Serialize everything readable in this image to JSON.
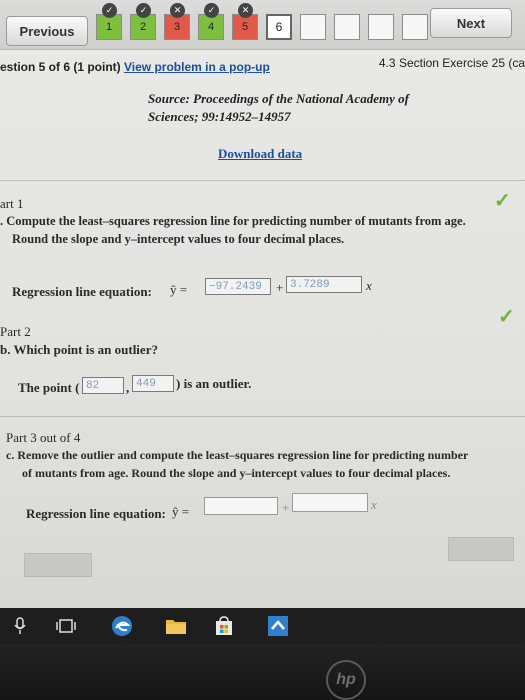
{
  "nav": {
    "previous_label": "Previous",
    "next_label": "Next",
    "questions": [
      {
        "label": "1",
        "state": "green",
        "badge": "✓"
      },
      {
        "label": "2",
        "state": "green",
        "badge": "✓"
      },
      {
        "label": "3",
        "state": "red",
        "badge": "✕"
      },
      {
        "label": "4",
        "state": "green",
        "badge": "✓"
      },
      {
        "label": "5",
        "state": "red",
        "badge": "✕"
      },
      {
        "label": "6",
        "state": "current",
        "badge": ""
      },
      {
        "label": "",
        "state": "white",
        "badge": ""
      },
      {
        "label": "",
        "state": "white",
        "badge": ""
      },
      {
        "label": "",
        "state": "white",
        "badge": ""
      },
      {
        "label": "",
        "state": "white",
        "badge": ""
      }
    ]
  },
  "question": {
    "info": "estion 5 of 6 (1 point)",
    "view_link": "View problem in a pop-up",
    "section": "4.3 Section Exercise 25 (ca"
  },
  "source": {
    "line1": "Source: Proceedings of the National Academy of",
    "line2": "Sciences; 99:14952–14957",
    "download_label": "Download data"
  },
  "part1": {
    "title": "art 1",
    "question_line1": ". Compute the least–squares regression line for predicting number of mutants from age.",
    "question_line2": "Round the slope and y–intercept values to four decimal places.",
    "eq_label": "Regression line equation:",
    "yhat": "ŷ =",
    "intercept": "−97.2439",
    "plus": "+",
    "slope": "3.7289",
    "x_var": "x"
  },
  "part2": {
    "title": "Part 2",
    "question": "b. Which point is an outlier?",
    "prefix": "The point (",
    "x_value": "82",
    "comma": ",",
    "y_value": "449",
    "suffix": ") is an outlier."
  },
  "part3": {
    "title": "Part 3 out of 4",
    "question_line1": "c. Remove the outlier and compute the least–squares regression line for predicting number",
    "question_line2": "of mutants from age. Round the slope and y–intercept values to four decimal places.",
    "eq_label": "Regression line equation:",
    "yhat": "ŷ =",
    "plus": "+",
    "x_var": "x"
  },
  "colors": {
    "accent_green": "#7fbf3f",
    "error_red": "#e05a4a",
    "link_blue": "#1a4fa0"
  },
  "taskbar": {
    "icons": [
      "microphone-icon",
      "task-view-icon",
      "browser-icon",
      "file-explorer-icon",
      "store-icon",
      "app-icon"
    ]
  },
  "bezel": {
    "logo": "hp"
  }
}
